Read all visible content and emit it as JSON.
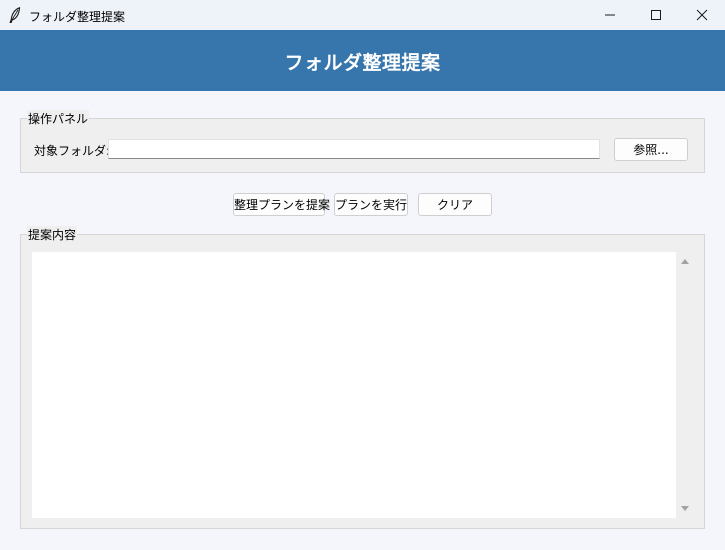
{
  "window": {
    "title": "フォルダ整理提案",
    "icon": "feather-icon"
  },
  "header": {
    "title": "フォルダ整理提案",
    "background_color": "#3676ad"
  },
  "panel": {
    "label": "操作パネル",
    "folder_label": "対象フォルダ:",
    "folder_value": "",
    "browse_label": "参照..."
  },
  "actions": {
    "suggest_label": "整理プランを提案",
    "execute_label": "プランを実行",
    "clear_label": "クリア"
  },
  "content": {
    "label": "提案内容",
    "text": ""
  }
}
